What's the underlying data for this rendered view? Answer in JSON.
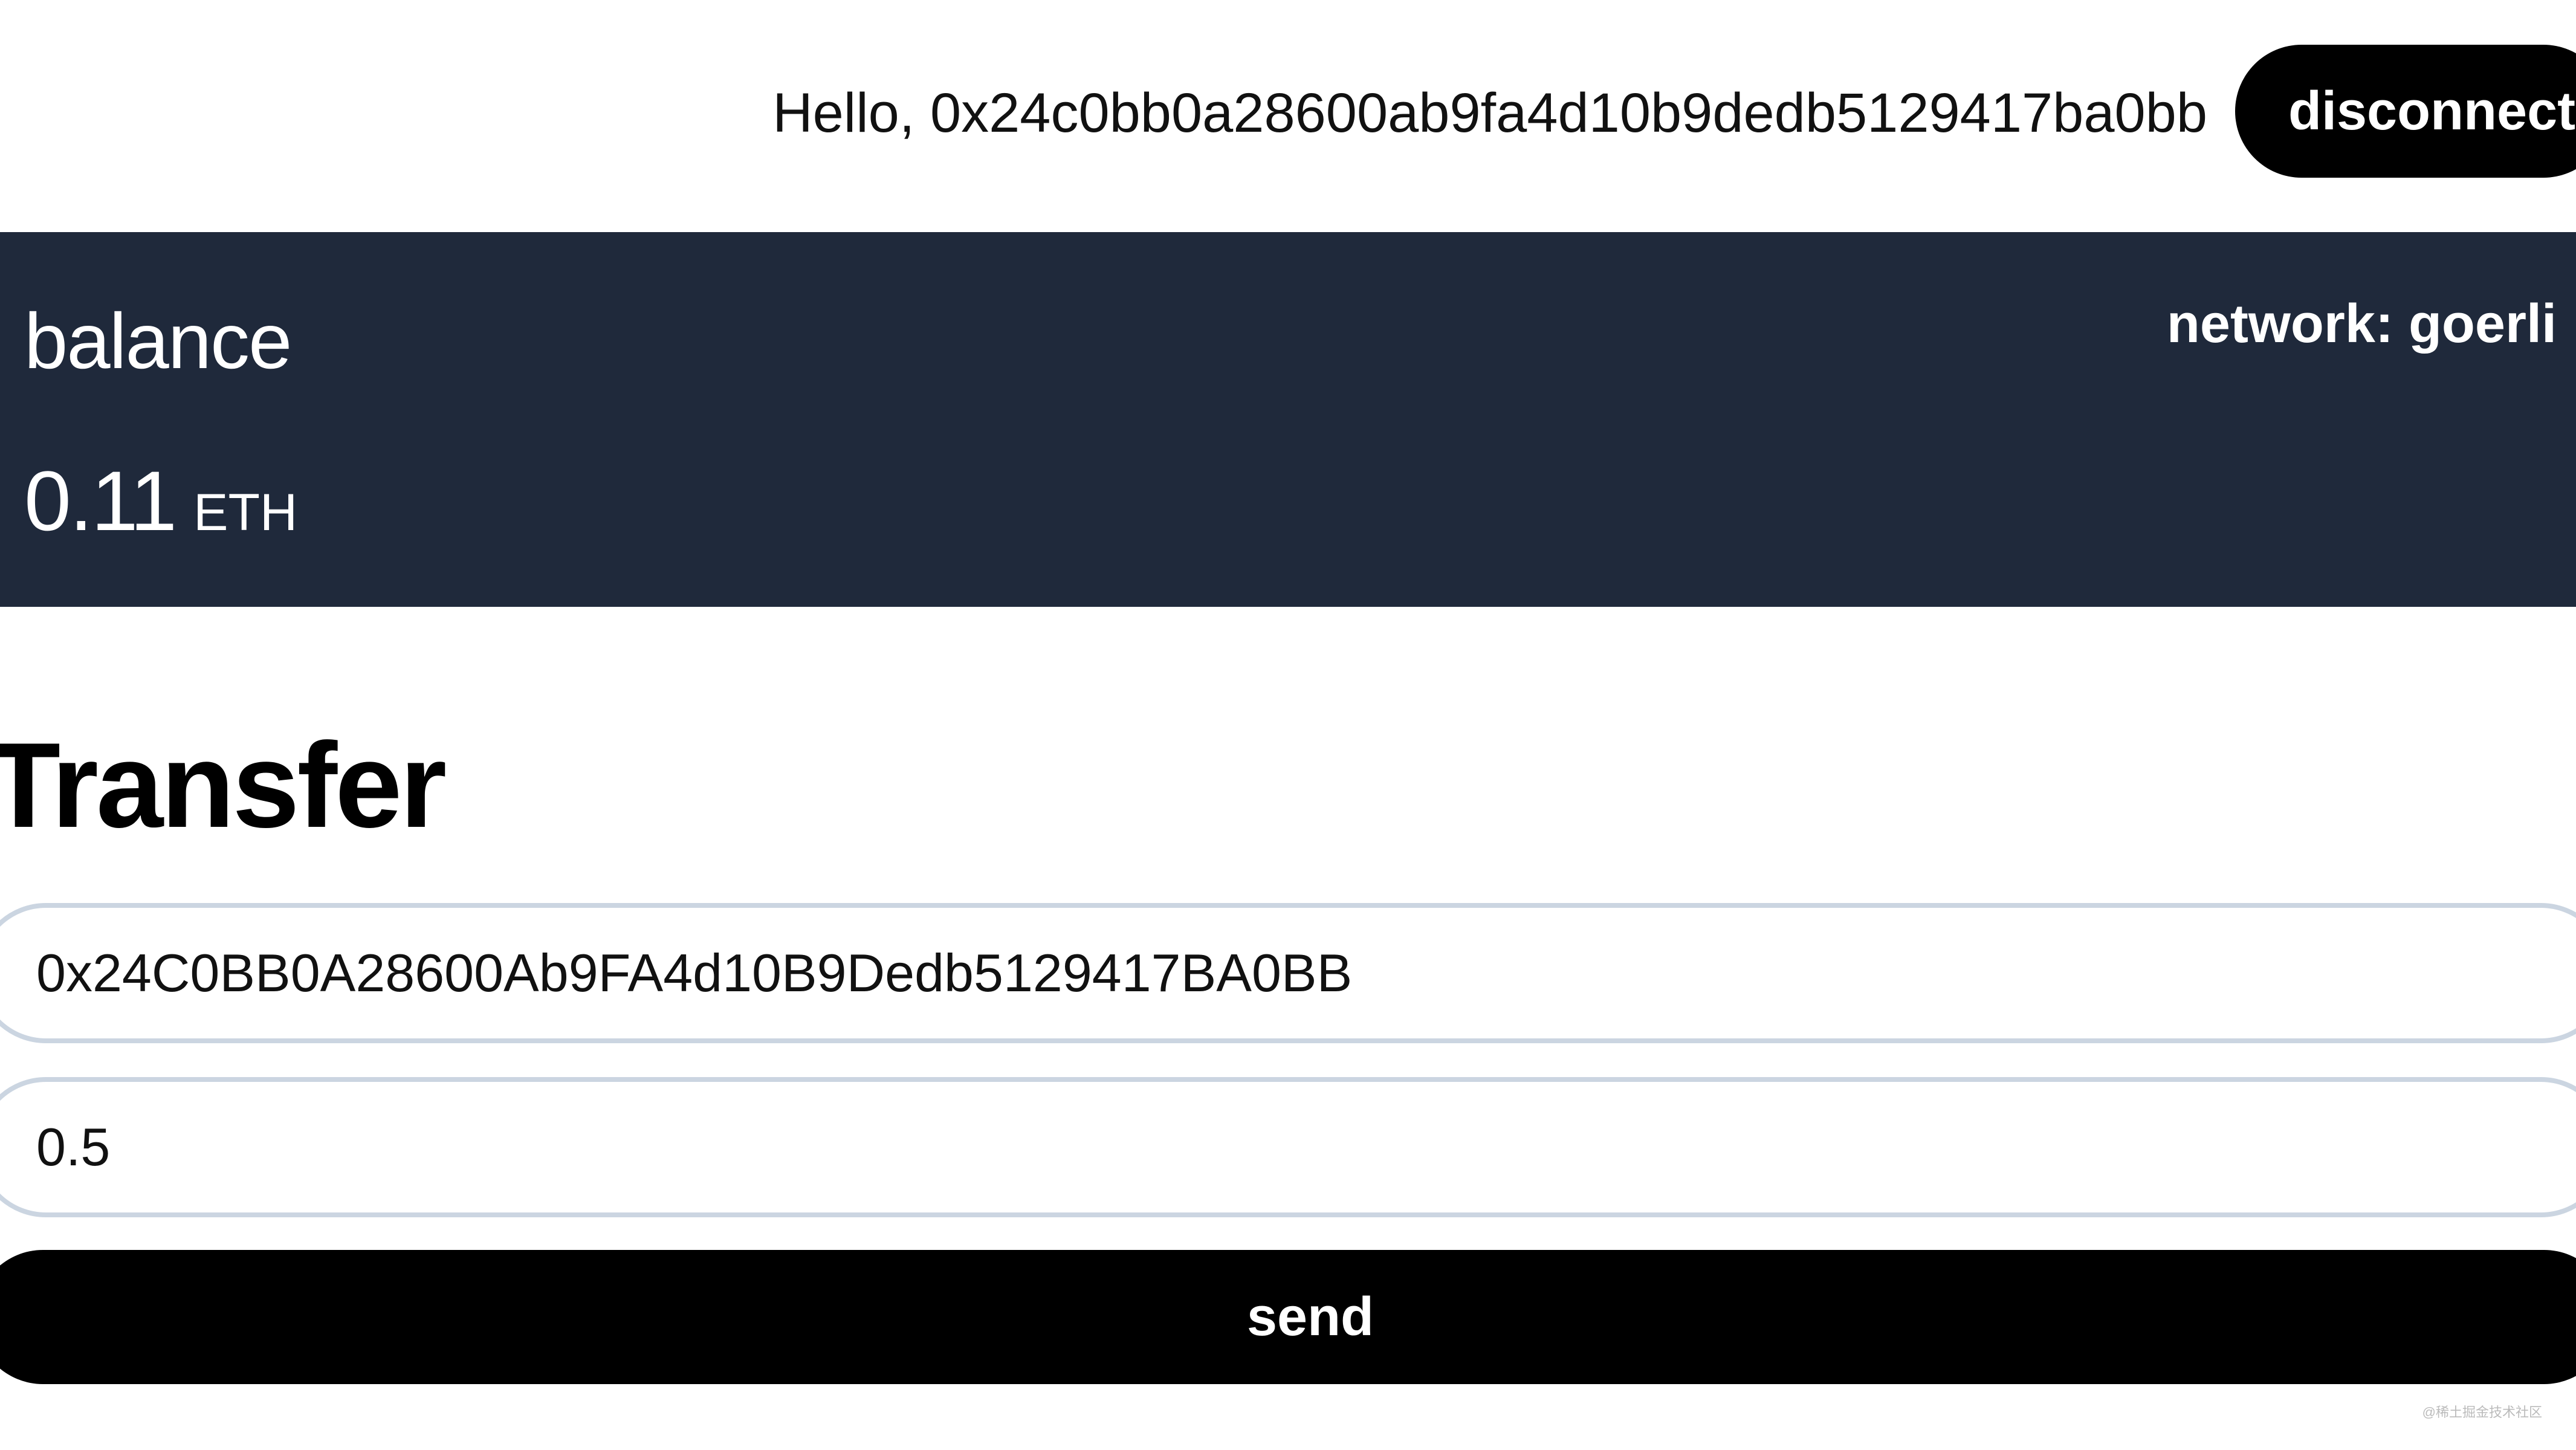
{
  "header": {
    "greeting": "Hello, 0x24c0bb0a28600ab9fa4d10b9dedb5129417ba0bb",
    "disconnect_label": "disconnect"
  },
  "balance_panel": {
    "label": "balance",
    "network": "network: goerli",
    "value": "0.11",
    "unit": "ETH",
    "background_color": "#1f293b"
  },
  "transfer": {
    "title": "Transfer",
    "address_value": "0x24C0BB0A28600Ab9FA4d10B9Dedb5129417BA0BB",
    "amount_value": "0.5",
    "send_label": "send"
  },
  "watermark": "@稀土掘金技术社区",
  "colors": {
    "button": "#000000",
    "input_border": "#cbd5e1",
    "panel": "#1f293b"
  }
}
